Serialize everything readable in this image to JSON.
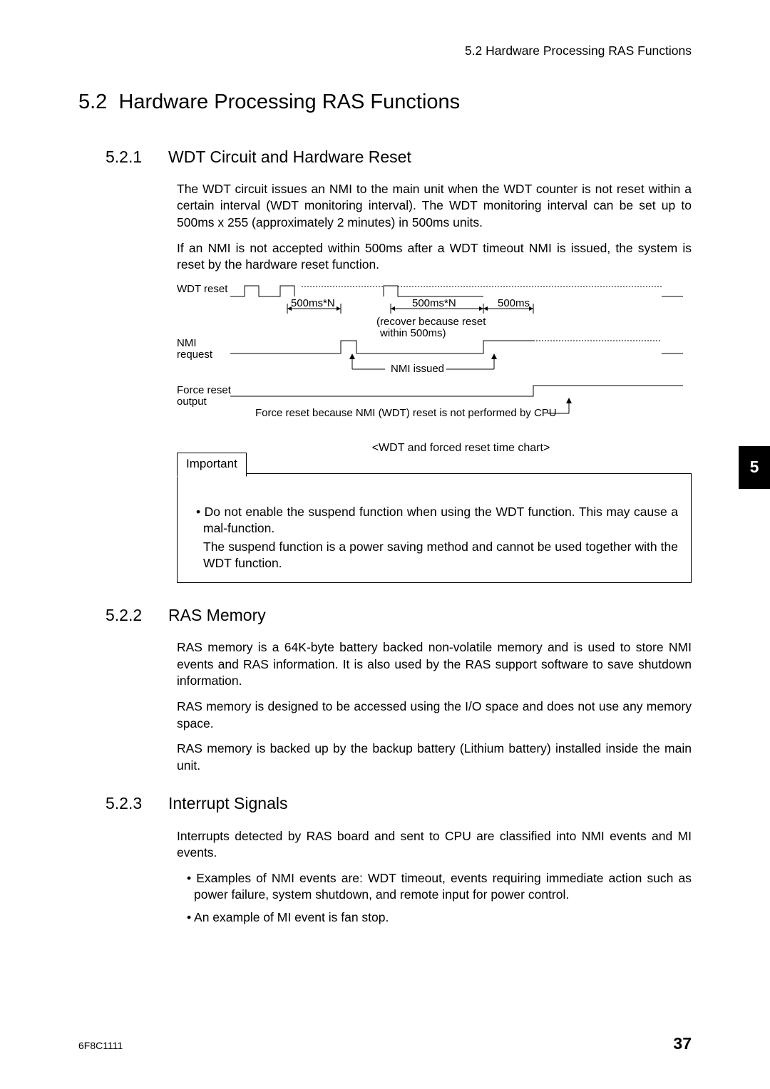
{
  "header": "5.2  Hardware Processing RAS Functions",
  "section": {
    "num": "5.2",
    "title": "Hardware Processing RAS Functions"
  },
  "sub1": {
    "num": "5.2.1",
    "title": "WDT Circuit and Hardware Reset",
    "p1": "The WDT circuit issues an NMI to the main unit when the WDT counter is not reset within a certain interval (WDT monitoring interval). The WDT monitoring interval can be set up to 500ms x 255 (approximately 2 minutes) in 500ms units.",
    "p2": "If an NMI is not accepted within 500ms after a WDT timeout NMI is issued, the system is reset by the hardware reset function."
  },
  "chart": {
    "wdt_reset": "WDT reset",
    "nmi_req": "NMI\nrequest",
    "force_reset": "Force reset\noutput",
    "span1": "500ms*N",
    "span2": "500ms*N",
    "span3": "500ms",
    "recover": "(recover because reset\nwithin 500ms)",
    "nmi_issued": "NMI issued",
    "force_note": "Force reset because NMI (WDT) reset is not performed by CPU",
    "caption": "<WDT and forced reset time chart>"
  },
  "important": {
    "label": "Important",
    "bullet": "Do not enable the suspend function when using the WDT function. This may cause a mal-function.",
    "sub": "The suspend function is a power saving method and cannot be used together with the WDT function."
  },
  "sub2": {
    "num": "5.2.2",
    "title": "RAS Memory",
    "p1": "RAS memory is a 64K-byte battery backed non-volatile memory and is used to store NMI events and RAS information. It is also used by the RAS support software to save shutdown information.",
    "p2": "RAS memory is designed to be accessed using the I/O space and does not use any memory space.",
    "p3": "RAS memory is backed up by the backup battery (Lithium battery) installed inside the main unit."
  },
  "sub3": {
    "num": "5.2.3",
    "title": "Interrupt Signals",
    "p1": "Interrupts detected by RAS board and sent to CPU are classified into NMI events and MI events.",
    "b1": "Examples of NMI events are: WDT timeout, events requiring immediate action such as power failure, system shutdown, and remote input for power control.",
    "b2": "An example of MI event is fan stop."
  },
  "chapter_tab": "5",
  "footer": {
    "doc": "6F8C1111",
    "page": "37"
  }
}
